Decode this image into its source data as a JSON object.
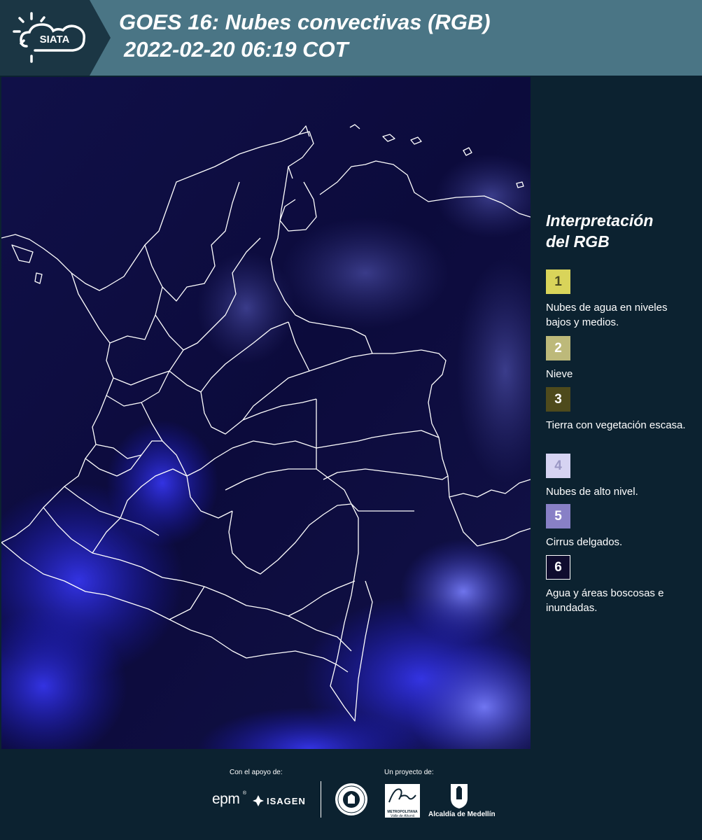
{
  "header": {
    "logo_text": "SIATA",
    "title_line1": "GOES 16: Nubes convectivas (RGB)",
    "title_line2": "2022-02-20 06:19 COT"
  },
  "legend": {
    "title": "Interpretación del RGB",
    "items": [
      {
        "number": "1",
        "label": "Nubes de agua en niveles bajos y medios.",
        "color": "#d9d45a",
        "text_color": "#4a4a20"
      },
      {
        "number": "2",
        "label": "Nieve",
        "color": "#bdb97a",
        "text_color": "#ffffff"
      },
      {
        "number": "3",
        "label": "Tierra con vegetación escasa.",
        "color": "#4e4a1c",
        "text_color": "#ffffff"
      },
      {
        "number": "4",
        "label": "Nubes de alto nivel.",
        "color": "#d6d3f2",
        "text_color": "#9a97c4"
      },
      {
        "number": "5",
        "label": "Cirrus delgados.",
        "color": "#8880c6",
        "text_color": "#ffffff"
      },
      {
        "number": "6",
        "label": "Agua y áreas boscosas e inundadas.",
        "color": "#0f0c2e",
        "text_color": "#ffffff"
      }
    ]
  },
  "footer": {
    "support_caption": "Con el apoyo de:",
    "project_caption": "Un proyecto de:",
    "epm": "epm",
    "isagen": "ISAGEN",
    "metropolitana": "METROPOLITANA",
    "valle": "Valle de Aburrá",
    "alcaldia": "Alcaldía de Medellín"
  },
  "colors": {
    "header_bg": "#4a7585",
    "panel_bg": "#0c2230",
    "map_bg": "#0b0a3a",
    "border_lines": "#ffffff"
  }
}
